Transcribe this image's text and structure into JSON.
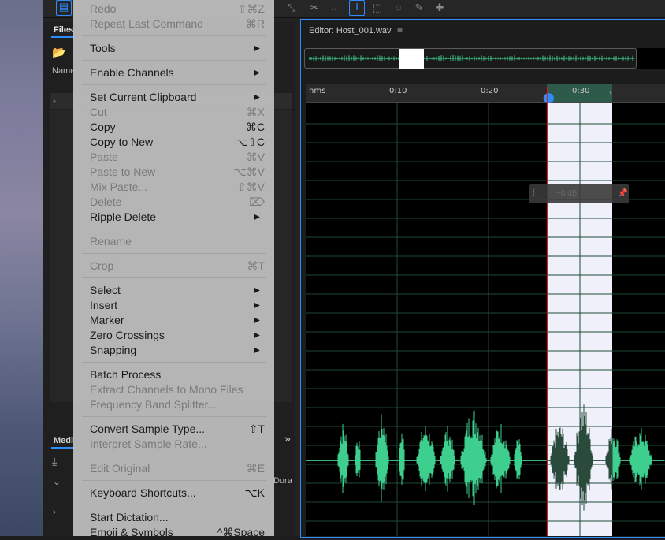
{
  "left_panel": {
    "files_tab": "Files",
    "name_column": "Name",
    "media_tab": "Medi",
    "duration_column": "Dura"
  },
  "editor": {
    "title": "Editor: Host_001.wav",
    "ruler_labels": [
      "hms",
      "0:10",
      "0:20",
      "0:30"
    ],
    "hud_time": "+0 dB",
    "waveform_color": "#3ecf8e",
    "selection_color": "#f0f0fa",
    "accent_color": "#2f8cff"
  },
  "menu": {
    "items": [
      {
        "label": "Redo",
        "shortcut": "⇧⌘Z",
        "disabled": true
      },
      {
        "label": "Repeat Last Command",
        "shortcut": "⌘R",
        "disabled": true
      },
      {
        "label": "Tools",
        "shortcut": "▶",
        "disabled": false
      },
      {
        "label": "Enable Channels",
        "shortcut": "▶",
        "disabled": false
      },
      {
        "label": "Set Current Clipboard",
        "shortcut": "▶",
        "disabled": false
      },
      {
        "label": "Cut",
        "shortcut": "⌘X",
        "disabled": true
      },
      {
        "label": "Copy",
        "shortcut": "⌘C",
        "disabled": false
      },
      {
        "label": "Copy to New",
        "shortcut": "⌥⇧C",
        "disabled": false
      },
      {
        "label": "Paste",
        "shortcut": "⌘V",
        "disabled": true
      },
      {
        "label": "Paste to New",
        "shortcut": "⌥⌘V",
        "disabled": true
      },
      {
        "label": "Mix Paste...",
        "shortcut": "⇧⌘V",
        "disabled": true
      },
      {
        "label": "Delete",
        "shortcut": "⌦",
        "disabled": true
      },
      {
        "label": "Ripple Delete",
        "shortcut": "▶",
        "disabled": false
      },
      {
        "label": "Rename",
        "shortcut": "",
        "disabled": true
      },
      {
        "label": "Crop",
        "shortcut": "⌘T",
        "disabled": true
      },
      {
        "label": "Select",
        "shortcut": "▶",
        "disabled": false
      },
      {
        "label": "Insert",
        "shortcut": "▶",
        "disabled": false
      },
      {
        "label": "Marker",
        "shortcut": "▶",
        "disabled": false
      },
      {
        "label": "Zero Crossings",
        "shortcut": "▶",
        "disabled": false
      },
      {
        "label": "Snapping",
        "shortcut": "▶",
        "disabled": false
      },
      {
        "label": "Batch Process",
        "shortcut": "",
        "disabled": false
      },
      {
        "label": "Extract Channels to Mono Files",
        "shortcut": "",
        "disabled": true
      },
      {
        "label": "Frequency Band Splitter...",
        "shortcut": "",
        "disabled": true
      },
      {
        "label": "Convert Sample Type...",
        "shortcut": "⇧T",
        "disabled": false
      },
      {
        "label": "Interpret Sample Rate...",
        "shortcut": "",
        "disabled": true
      },
      {
        "label": "Edit Original",
        "shortcut": "⌘E",
        "disabled": true
      },
      {
        "label": "Keyboard Shortcuts...",
        "shortcut": "⌥K",
        "disabled": false
      },
      {
        "label": "Start Dictation...",
        "shortcut": "",
        "disabled": false
      },
      {
        "label": "Emoji & Symbols",
        "shortcut": "^⌘Space",
        "disabled": false
      }
    ]
  }
}
